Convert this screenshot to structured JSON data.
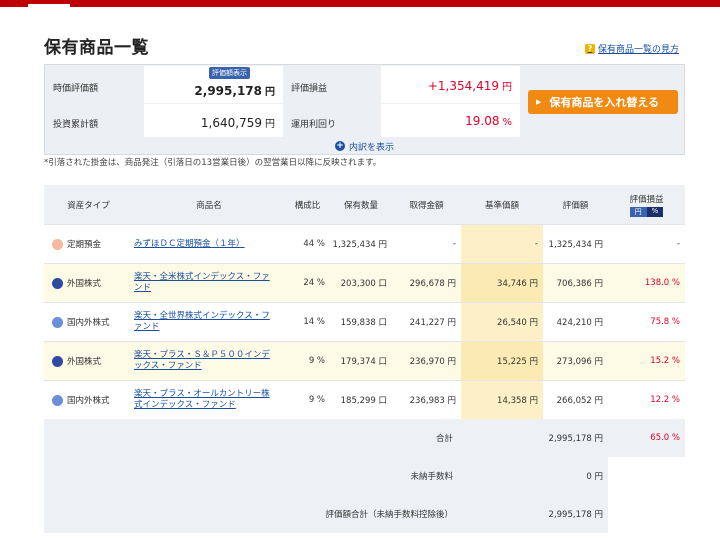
{
  "page_title": "保有商品一覧",
  "help_link": "保有商品一覧の見方",
  "summary": {
    "market_value_label": "時価評価額",
    "market_value_badge": "評価額表示",
    "market_value": "2,995,178",
    "unit_yen": "円",
    "profit_label": "評価損益",
    "profit_value": "+1,354,419",
    "invested_label": "投資累計額",
    "invested_value": "1,640,759",
    "yield_label": "運用利回り",
    "yield_value": "19.08",
    "yield_unit": "%",
    "swap_button": "保有商品を入れ替える",
    "breakdown_label": "内訳を表示"
  },
  "note": "*引落された掛金は、商品発注（引落日の13営業日後）の翌営業日以降に反映されます。",
  "table": {
    "headers": {
      "asset_type": "資産タイプ",
      "product_name": "商品名",
      "ratio": "構成比",
      "quantity": "保有数量",
      "cost": "取得金額",
      "base_price": "基準価額",
      "valuation": "評価額",
      "profit": "評価損益",
      "toggle_yen": "円",
      "toggle_pct": "%"
    },
    "rows": [
      {
        "type": "定期預金",
        "color": "#f5b8a0",
        "name": "みずほＤＣ定期預金（１年）",
        "ratio": "44 %",
        "quantity": "1,325,434 円",
        "cost": "-",
        "base": "-",
        "valuation": "1,325,434 円",
        "profit": "-"
      },
      {
        "type": "外国株式",
        "color": "#2f4aa0",
        "name": "楽天・全米株式インデックス・ファンド",
        "ratio": "24 %",
        "quantity": "203,300 口",
        "cost": "296,678 円",
        "base": "34,746 円",
        "valuation": "706,386 円",
        "profit": "138.0 %"
      },
      {
        "type": "国内外株式",
        "color": "#6b8fd8",
        "name": "楽天・全世界株式インデックス・ファンド",
        "ratio": "14 %",
        "quantity": "159,838 口",
        "cost": "241,227 円",
        "base": "26,540 円",
        "valuation": "424,210 円",
        "profit": "75.8 %"
      },
      {
        "type": "外国株式",
        "color": "#2f4aa0",
        "name": "楽天・プラス・Ｓ＆Ｐ５００インデックス・ファンド",
        "ratio": "9 %",
        "quantity": "179,374 口",
        "cost": "236,970 円",
        "base": "15,225 円",
        "valuation": "273,096 円",
        "profit": "15.2 %"
      },
      {
        "type": "国内外株式",
        "color": "#6b8fd8",
        "name": "楽天・プラス・オールカントリー株式インデックス・ファンド",
        "ratio": "9 %",
        "quantity": "185,299 口",
        "cost": "236,983 円",
        "base": "14,358 円",
        "valuation": "266,052 円",
        "profit": "12.2 %"
      }
    ],
    "totals": {
      "sum_label": "合計",
      "sum_value": "2,995,178 円",
      "sum_profit": "65.0 %",
      "unpaid_label": "未納手数料",
      "unpaid_value": "0 円",
      "net_label": "評価額合計（未納手数料控除後）",
      "net_value": "2,995,178 円"
    }
  }
}
